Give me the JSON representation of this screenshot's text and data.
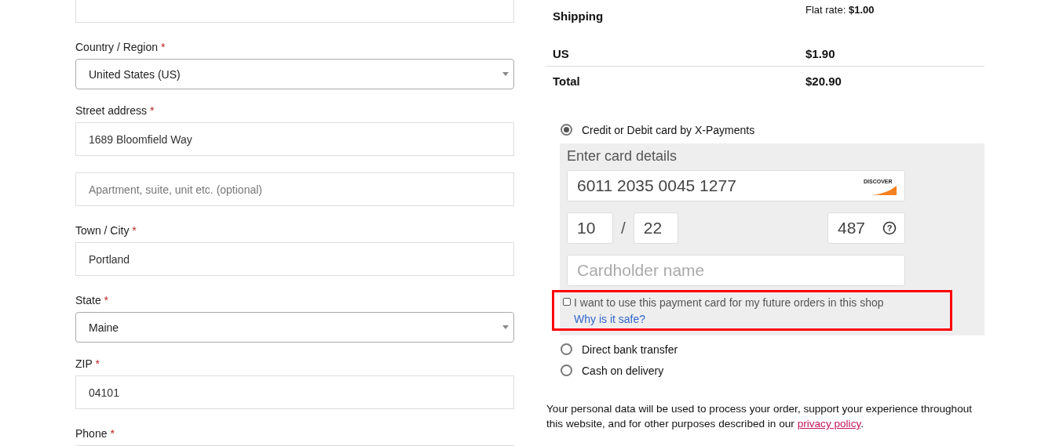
{
  "billing_form": {
    "fields": [
      {
        "kind": "input"
      },
      {
        "kind": "select",
        "label": "Country / Region",
        "required": true,
        "value": "United States (US)"
      },
      {
        "kind": "input",
        "label": "Street address",
        "required": true,
        "value": "1689 Bloomfield Way"
      },
      {
        "kind": "input",
        "placeholder": "Apartment, suite, unit etc. (optional)"
      },
      {
        "kind": "input",
        "label": "Town / City",
        "required": true,
        "value": "Portland"
      },
      {
        "kind": "select",
        "label": "State",
        "required": true,
        "value": "Maine"
      },
      {
        "kind": "input",
        "label": "ZIP",
        "required": true,
        "value": "04101"
      },
      {
        "kind": "input",
        "label": "Phone",
        "required": true
      }
    ]
  },
  "required_mark": "*",
  "order_summary": {
    "rows": [
      {
        "label": "Shipping",
        "value": "Flat rate: ",
        "amount": "$1.00",
        "kind": "shipping"
      },
      {
        "label": "US",
        "amount": "$1.90",
        "kind": "tax"
      },
      {
        "label": "Total",
        "amount": "$20.90",
        "kind": "total"
      }
    ]
  },
  "payment_methods": [
    {
      "label": "Credit or Debit card by X-Payments",
      "selected": true,
      "kind": "card"
    },
    {
      "label": "Direct bank transfer",
      "selected": false,
      "kind": "plain"
    },
    {
      "label": "Cash on delivery",
      "selected": false,
      "kind": "plain"
    }
  ],
  "card_form": {
    "heading": "Enter card details",
    "card_number": "6011 2035 0045 1277",
    "card_brand": "DISCOVER",
    "exp_month": "10",
    "separator": "/",
    "exp_year": "22",
    "cvv": "487",
    "cvv_help": "?",
    "cardholder_placeholder": "Cardholder name",
    "save_card": {
      "label": "I want to use this payment card for my future orders in this shop",
      "checked": false,
      "highlighted": true
    },
    "safety_link": "Why is it safe?"
  },
  "privacy_notice": {
    "text": "Your personal data will be used to process your order, support your experience throughout this website, and for other purposes described in our ",
    "link": "privacy policy",
    "end": "."
  }
}
